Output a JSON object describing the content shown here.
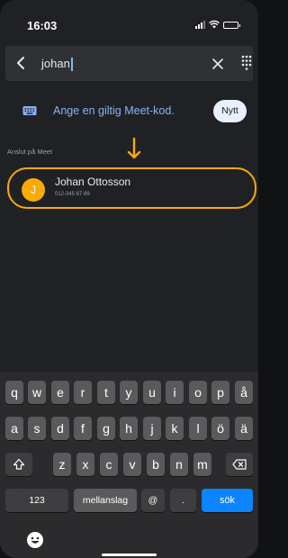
{
  "status_bar": {
    "time": "16:03"
  },
  "search": {
    "query": "johan"
  },
  "meet_code": {
    "prompt": "Ange en giltig Meet-kod.",
    "new_button": "Nytt"
  },
  "section": {
    "label": "Anslut på Meet"
  },
  "contact": {
    "initial": "J",
    "name": "Johan Ottosson",
    "number": "012-345 67 89"
  },
  "colors": {
    "accent": "#8ab4f8",
    "highlight": "#f9ab00",
    "background": "#202124",
    "send_key": "#0a84ff"
  },
  "icons": [
    "back-arrow-icon",
    "clear-icon",
    "dialpad-icon",
    "keyboard-icon",
    "down-arrow-icon",
    "shift-icon",
    "backspace-icon",
    "emoji-icon"
  ],
  "keyboard": {
    "row1": [
      "q",
      "w",
      "e",
      "r",
      "t",
      "y",
      "u",
      "i",
      "o",
      "p",
      "å"
    ],
    "row2": [
      "a",
      "s",
      "d",
      "f",
      "g",
      "h",
      "j",
      "k",
      "l",
      "ö",
      "ä"
    ],
    "row3": [
      "z",
      "x",
      "c",
      "v",
      "b",
      "n",
      "m"
    ],
    "numbers_key": "123",
    "space_key": "mellanslag",
    "at_key": "@",
    "dot_key": ".",
    "search_key": "sök"
  }
}
